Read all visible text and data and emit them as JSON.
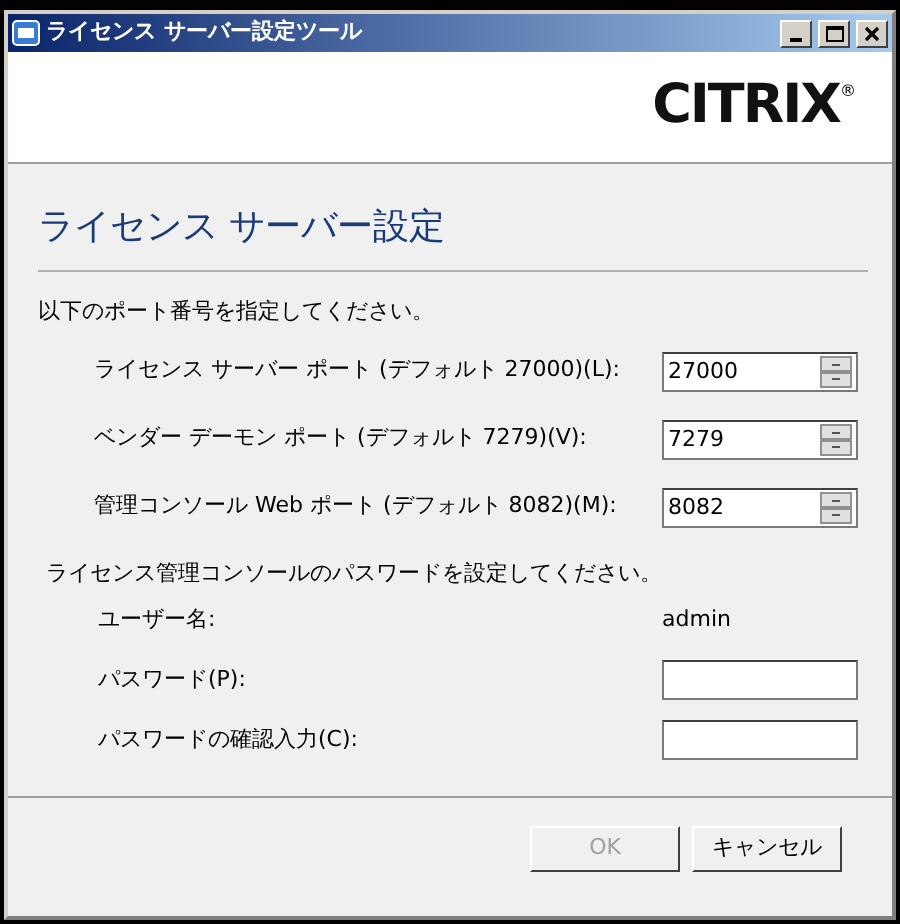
{
  "window": {
    "title": "ライセンス サーバー設定ツール"
  },
  "logo": {
    "text": "CITRIX",
    "mark": "®"
  },
  "heading": "ライセンス サーバー設定",
  "ports_instruction": "以下のポート番号を指定してください。",
  "ports": [
    {
      "label": "ライセンス サーバー ポート (デフォルト 27000)(L):",
      "value": "27000"
    },
    {
      "label": "ベンダー デーモン ポート (デフォルト 7279)(V):",
      "value": "7279"
    },
    {
      "label": "管理コンソール Web ポート (デフォルト 8082)(M):",
      "value": "8082"
    }
  ],
  "password_instruction": "ライセンス管理コンソールのパスワードを設定してください。",
  "credentials": [
    {
      "kind": "text",
      "label": "ユーザー名:",
      "value": "admin"
    },
    {
      "kind": "field",
      "label": "パスワード(P):"
    },
    {
      "kind": "field",
      "label": "パスワードの確認入力(C):"
    }
  ],
  "buttons": [
    {
      "label": "OK",
      "disabled": true
    },
    {
      "label": "キャンセル",
      "disabled": false
    }
  ]
}
